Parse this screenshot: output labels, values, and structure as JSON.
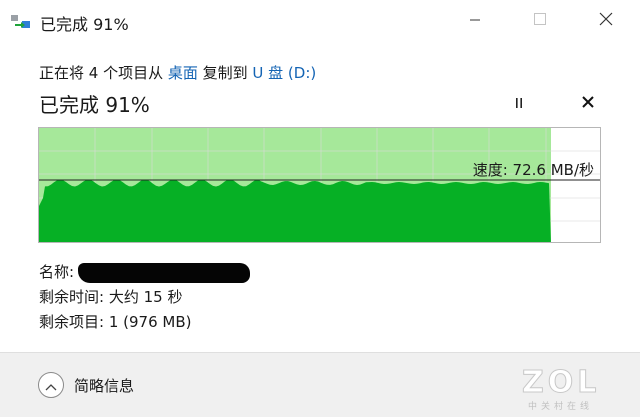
{
  "window": {
    "title": "已完成 91%",
    "icons": {
      "app": "copy-arrow-icon",
      "minimize": "minimize-icon",
      "maximize": "maximize-icon",
      "close": "close-icon"
    }
  },
  "copy_status": {
    "prefix": "正在将 4 个项目从 ",
    "source": "桌面",
    "middle": " 复制到 ",
    "destination": "U 盘 (D:)"
  },
  "progress": {
    "heading": "已完成 91%",
    "percent": 91,
    "pause_icon": "pause-icon",
    "cancel_icon": "cancel-icon"
  },
  "graph": {
    "speed_label": "速度: 72.6 MB/秒",
    "fill_color": "#06b025",
    "progress_bg_color": "#a6e89a",
    "current_speed_fraction": 0.45
  },
  "details": {
    "name_label": "名称:",
    "time_label": "剩余时间:",
    "time_value": "大约 15 秒",
    "items_label": "剩余项目:",
    "items_value": "1 (976 MB)"
  },
  "footer": {
    "collapse_label": "简略信息",
    "collapse_icon": "chevron-up-icon",
    "watermark": "ZOL",
    "watermark_sub": "中关村在线"
  }
}
